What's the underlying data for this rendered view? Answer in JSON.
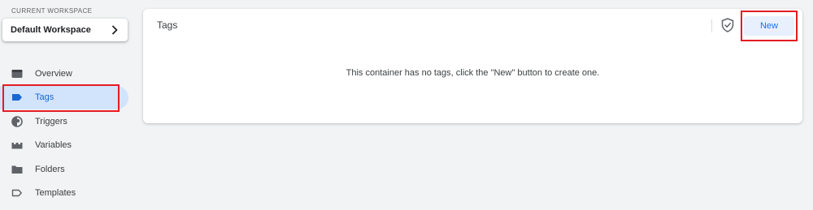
{
  "sidebar": {
    "workspace_caption": "CURRENT WORKSPACE",
    "workspace_name": "Default Workspace",
    "items": [
      {
        "label": "Overview",
        "icon": "overview-icon",
        "active": false
      },
      {
        "label": "Tags",
        "icon": "tag-icon",
        "active": true
      },
      {
        "label": "Triggers",
        "icon": "trigger-icon",
        "active": false
      },
      {
        "label": "Variables",
        "icon": "variables-icon",
        "active": false
      },
      {
        "label": "Folders",
        "icon": "folder-icon",
        "active": false
      },
      {
        "label": "Templates",
        "icon": "template-icon",
        "active": false
      }
    ]
  },
  "main": {
    "title": "Tags",
    "new_button_label": "New",
    "empty_message": "This container has no tags, click the \"New\" button to create one."
  },
  "colors": {
    "background": "#f1f3f4",
    "accent": "#1a73e8",
    "active_nav_bg": "#d2e3fc",
    "highlight": "#e51c23"
  }
}
